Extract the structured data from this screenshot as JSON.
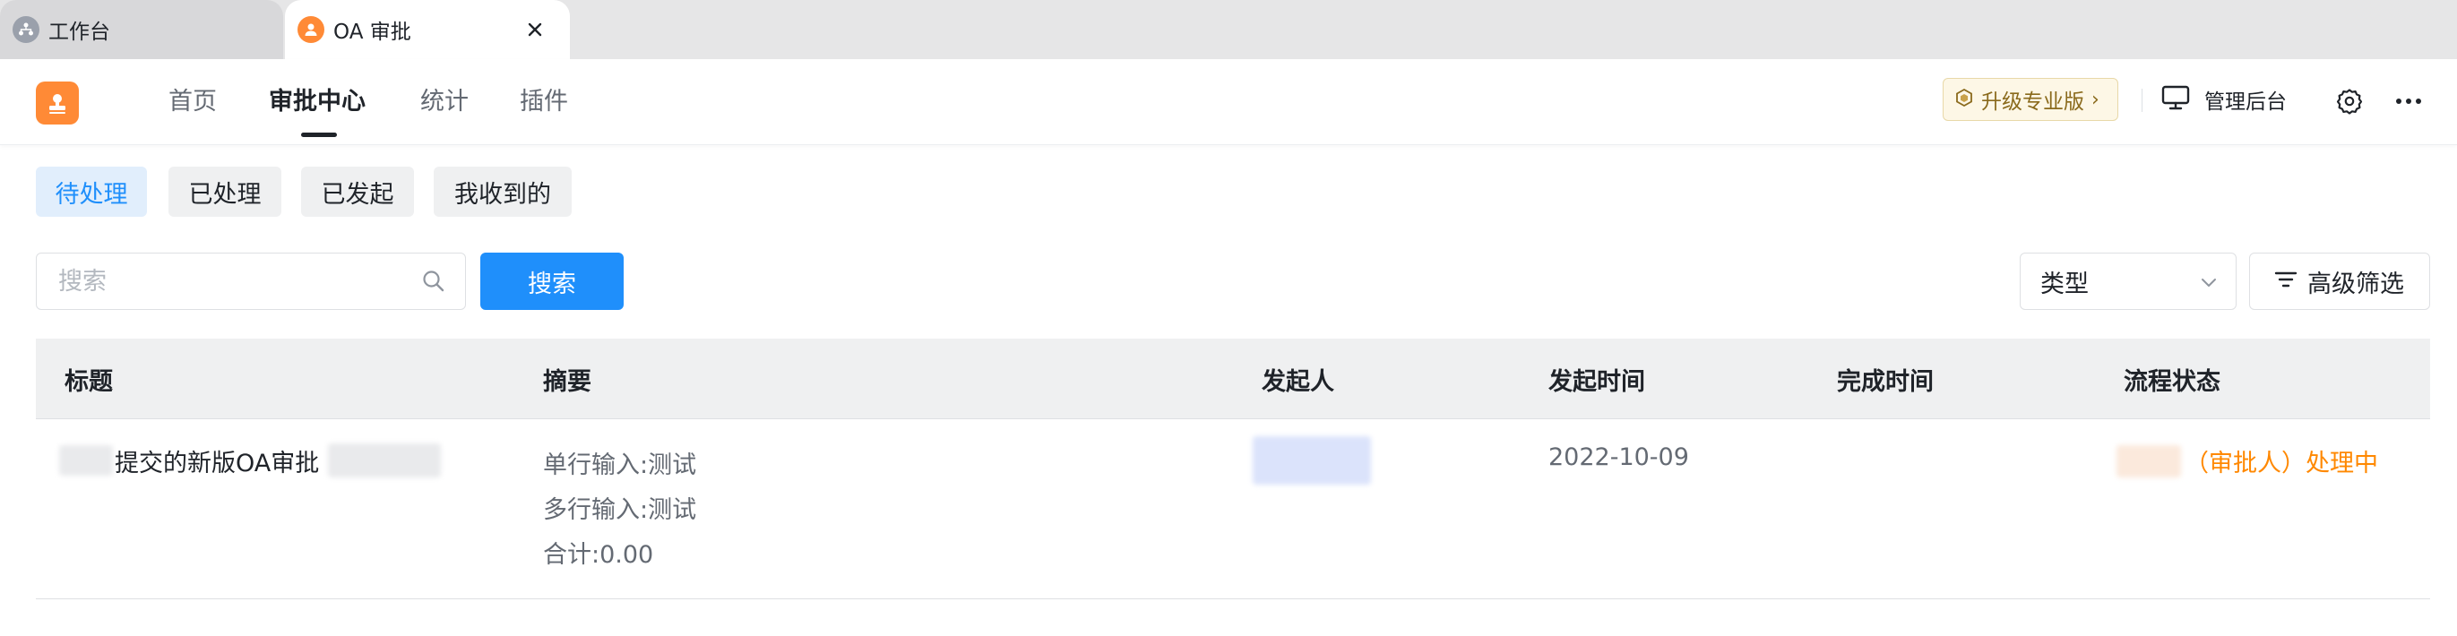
{
  "browser_tabs": [
    {
      "label": "工作台",
      "icon": "org-chart-icon",
      "active": false
    },
    {
      "label": "OA 审批",
      "icon": "user-icon",
      "active": true,
      "close": "×"
    }
  ],
  "nav": {
    "items": [
      "首页",
      "审批中心",
      "统计",
      "插件"
    ],
    "active": "审批中心",
    "upgrade_label": "升级专业版",
    "upgrade_chevron": "›",
    "admin_label": "管理后台"
  },
  "filter_tabs": [
    {
      "label": "待处理",
      "active": true
    },
    {
      "label": "已处理",
      "active": false
    },
    {
      "label": "已发起",
      "active": false
    },
    {
      "label": "我收到的",
      "active": false
    }
  ],
  "search": {
    "placeholder": "搜索",
    "button_label": "搜索"
  },
  "type_select": {
    "value": "类型"
  },
  "advanced_filter_label": "高级筛选",
  "table": {
    "columns": [
      "标题",
      "摘要",
      "发起人",
      "发起时间",
      "完成时间",
      "流程状态"
    ],
    "rows": [
      {
        "title": "提交的新版OA审批",
        "summary": [
          "单行输入:测试",
          "多行输入:测试",
          "合计:0.00"
        ],
        "initiator": "",
        "start_time": "2022-10-09",
        "finish_time": "",
        "status": "（审批人）处理中"
      }
    ]
  },
  "colors": {
    "accent": "#1f8ffb",
    "brand_orange": "#ff8a36",
    "status_orange": "#ff8800"
  }
}
